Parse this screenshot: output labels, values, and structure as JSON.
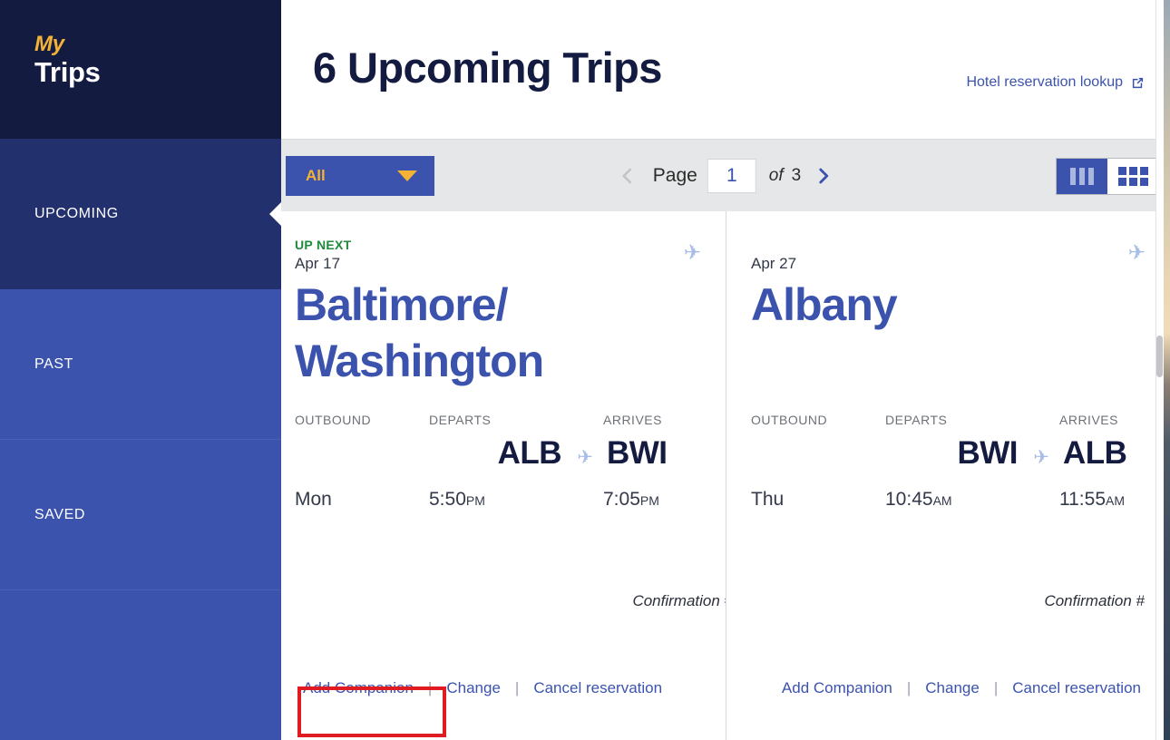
{
  "sidebar": {
    "brand": {
      "line1": "My",
      "line2": "Trips"
    },
    "items": [
      {
        "label": "UPCOMING",
        "selected": true
      },
      {
        "label": "PAST",
        "selected": false
      },
      {
        "label": "SAVED",
        "selected": false
      }
    ]
  },
  "header": {
    "title": "6 Upcoming Trips",
    "hotel_lookup_label": "Hotel reservation lookup",
    "hotel_lookup_icon": "external-link-icon"
  },
  "toolbar": {
    "filter_label": "All",
    "filter_caret_icon": "caret-down-icon",
    "pager": {
      "prev_icon": "chevron-left-icon",
      "next_icon": "chevron-right-icon",
      "page_label": "Page",
      "current_page": "1",
      "of_label": "of",
      "total_pages": "3"
    },
    "views": [
      {
        "name": "column-view",
        "icon": "columns-icon",
        "active": true
      },
      {
        "name": "grid-view",
        "icon": "grid-icon",
        "active": false
      }
    ]
  },
  "cards": [
    {
      "badge": "UP NEXT",
      "date": "Apr 17",
      "city": "Baltimore/ Washington",
      "plane_icon": "airplane-icon",
      "headers": {
        "outbound": "OUTBOUND",
        "departs": "DEPARTS",
        "arrives": "ARRIVES"
      },
      "depart_code": "ALB",
      "arrive_code": "BWI",
      "route_icon": "airplane-right-icon",
      "day": "Mon",
      "depart_time": "5:50",
      "depart_meridiem": "PM",
      "arrive_time": "7:05",
      "arrive_meridiem": "PM",
      "confirmation": "Confirmation #",
      "actions": {
        "add_companion": "Add Companion",
        "change": "Change",
        "cancel": "Cancel reservation",
        "separator": "|"
      }
    },
    {
      "badge": "",
      "date": "Apr 27",
      "city": "Albany",
      "plane_icon": "airplane-icon",
      "headers": {
        "outbound": "OUTBOUND",
        "departs": "DEPARTS",
        "arrives": "ARRIVES"
      },
      "depart_code": "BWI",
      "arrive_code": "ALB",
      "route_icon": "airplane-right-icon",
      "day": "Thu",
      "depart_time": "10:45",
      "depart_meridiem": "AM",
      "arrive_time": "11:55",
      "arrive_meridiem": "AM",
      "confirmation": "Confirmation #",
      "actions": {
        "add_companion": "Add Companion",
        "change": "Change",
        "cancel": "Cancel reservation",
        "separator": "|"
      }
    }
  ],
  "colors": {
    "brand_navy": "#141b41",
    "brand_blue": "#3b53ad",
    "brand_gold": "#f5b335",
    "selected_nav": "#23306e",
    "up_next_green": "#1e8a3c",
    "highlight_red": "#e11b22",
    "toolbar_gray": "#e6e7e8"
  }
}
